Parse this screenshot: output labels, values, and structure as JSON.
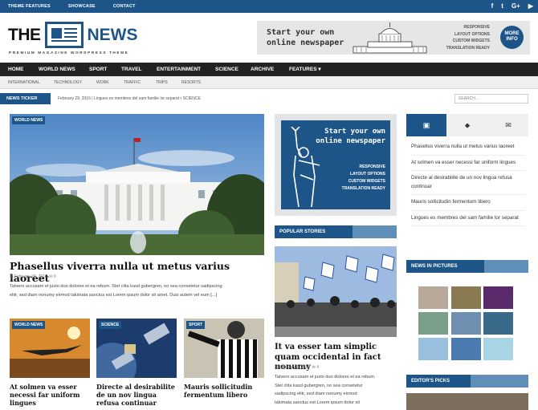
{
  "topbar": {
    "links": [
      "THEME FEATURES",
      "SHOWCASE",
      "CONTACT"
    ],
    "social": [
      {
        "icon": "facebook-icon",
        "glyph": "f"
      },
      {
        "icon": "twitter-icon",
        "glyph": "t"
      },
      {
        "icon": "google-plus-icon",
        "glyph": "G+"
      },
      {
        "icon": "youtube-icon",
        "glyph": "▶"
      }
    ]
  },
  "logo": {
    "the": "THE",
    "news": "NEWS",
    "tagline": "PREMIUM MAGAZINE WORDPRESS THEME"
  },
  "header_banner": {
    "headline_1": "Start your own",
    "headline_2": "online newspaper",
    "features": [
      "RESPONSIVE",
      "LAYOUT OPTIONS",
      "CUSTOM WIDGETS",
      "TRANSLATION READY"
    ],
    "more_1": "MORE",
    "more_2": "INFO"
  },
  "nav": {
    "items": [
      "HOME",
      "WORLD NEWS",
      "SPORT",
      "TRAVEL",
      "ENTERTAINMENT",
      "SCIENCE",
      "ARCHIVE",
      "FEATURES ▾"
    ]
  },
  "subnav": {
    "items": [
      "INTERNATIONAL",
      "TECHNOLOGY",
      "WORK",
      "TRAFFIC",
      "TRIPS",
      "RESORTS"
    ]
  },
  "ticker": {
    "label": "NEWS TICKER",
    "text": "February 29, 2016 | Lingues es membres del sam familie lor separat  •  SCIENCE",
    "search_placeholder": "SEARCH..."
  },
  "hero": {
    "tag": "WORLD NEWS",
    "title": "Phasellus viverra nulla ut metus varius laoreet",
    "date": "February 29, 2016",
    "comments": "0",
    "excerpt_1": "Tatvero accusam et justo duo dolores et ea rebum. Stet clita kasd gubergren, no sea consetetur sadipscing",
    "excerpt_2": "elitr, sed diam nonumy eirmod takimata sanctus est Lorem ipsum dolor sit amet. Duis autem vel eum [...]"
  },
  "thumbs": [
    {
      "tag": "WORLD NEWS",
      "title": "At solmen va esser necessi far uniform lingues"
    },
    {
      "tag": "SCIENCE",
      "title": "Directe al desirabilite de un nov lingua refusa continuar"
    },
    {
      "tag": "SPORT",
      "title": "Mauris sollicitudin fermentum libero"
    }
  ],
  "mid_ad": {
    "headline_1": "Start your own",
    "headline_2": "online newspaper",
    "features": [
      "RESPONSIVE",
      "LAYOUT OPTIONS",
      "CUSTOM WIDGETS",
      "TRANSLATION READY"
    ]
  },
  "popular": {
    "heading": "POPULAR STORIES",
    "title": "It va esser tam simplic quam occidental in fact nonumy",
    "date": "February 1, 2016",
    "comments": "4",
    "excerpt_1": "Tatvero accusam et justo duo dolores et ea rebum.",
    "excerpt_2": "Stet clita kasd gubergren, no sea consetetur",
    "excerpt_3": "sadipscing elitr, sed diam nonumy eirmod",
    "excerpt_4": "takimata sanctus est Lorem ipsum dolor sit"
  },
  "sidebar": {
    "tabs": [
      {
        "icon": "image-icon",
        "glyph": "▣"
      },
      {
        "icon": "tags-icon",
        "glyph": "⬥"
      },
      {
        "icon": "comments-icon",
        "glyph": "✉"
      }
    ],
    "items": [
      "Phasellus viverra nulla ut metus varius laoreet",
      "At solmen va esser necessi far uniform lingues",
      "Directe al desirabilite de un nov lingua refusa continuar",
      "Mauris sollicitudin fermentum libero",
      "Lingues es membres del sam familie lor separat"
    ],
    "pictures_heading": "NEWS IN PICTURES",
    "picks_heading": "EDITOR'S PICKS"
  },
  "colors": {
    "brand": "#1e5588",
    "nav": "#222222",
    "accent_light": "#5f8fb8"
  }
}
